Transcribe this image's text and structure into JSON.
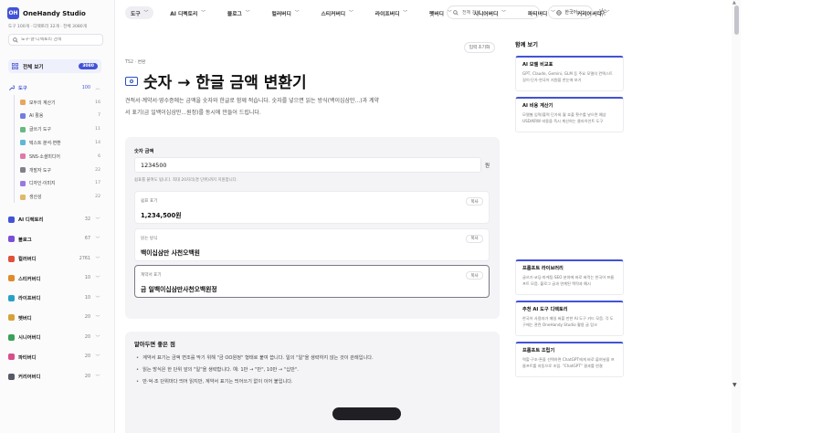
{
  "brand": {
    "logo_mark": "OH",
    "name": "OneHandy Studio"
  },
  "sidebar": {
    "stats": "도구 100개 · 디렉토리 32개 · 전체 3080개",
    "search_placeholder": "도구·글·디렉토리 검색",
    "all_view": {
      "label": "전체 보기",
      "count": "3080"
    },
    "tools": {
      "label": "도구",
      "count": "100"
    },
    "subitems": [
      {
        "label": "모두의 계산기",
        "count": "16"
      },
      {
        "label": "AI 활용",
        "count": "7"
      },
      {
        "label": "글쓰기 도구",
        "count": "11"
      },
      {
        "label": "텍스트 분석·변환",
        "count": "14"
      },
      {
        "label": "SNS·소셜미디어",
        "count": "6"
      },
      {
        "label": "개발자 도구",
        "count": "22"
      },
      {
        "label": "디자인·이미지",
        "count": "17"
      },
      {
        "label": "생산성",
        "count": "22"
      }
    ],
    "categories": [
      {
        "label": "AI 디렉토리",
        "count": "32",
        "color": "#4353d6"
      },
      {
        "label": "블로그",
        "count": "67",
        "color": "#7a4fd6"
      },
      {
        "label": "컬러버디",
        "count": "2761",
        "color": "#e0503a"
      },
      {
        "label": "스티커버디",
        "count": "10",
        "color": "#e08a2a"
      },
      {
        "label": "라이프버디",
        "count": "10",
        "color": "#2aa0c8"
      },
      {
        "label": "펫버디",
        "count": "20",
        "color": "#d6a23a"
      },
      {
        "label": "시니어버디",
        "count": "20",
        "color": "#3aa05a"
      },
      {
        "label": "파티버디",
        "count": "20",
        "color": "#d64f8a"
      },
      {
        "label": "커리어버디",
        "count": "20",
        "color": "#555a66"
      }
    ]
  },
  "topnav": {
    "items": [
      "도구",
      "AI 디렉토리",
      "블로그",
      "컬러버디",
      "스티커버디",
      "라이프버디",
      "펫버디",
      "시니어버디",
      "파티버디",
      "커리어버디"
    ],
    "search_placeholder": "전체 검색...",
    "language": "한국어"
  },
  "main": {
    "reset_label": "입력 초기화",
    "breadcrumb": [
      "TS2",
      "변환"
    ],
    "title": "숫자 → 한글 금액 변환기",
    "description": "견적서·계약서·영수증에는 금액을 숫자와 한글로 함께 적습니다. 숫자를 넣으면 읽는 방식(백이십삼만...)과 계약서 표기(금 일백이십삼만...원정)를 동시에 만들어 드립니다.",
    "input_label": "숫자 금액",
    "input_value": "1234500",
    "unit": "원",
    "hint": "쉼표를 붙여도 됩니다. 최대 20자리(경 단위)까지 지원합니다.",
    "results": [
      {
        "label": "쉼표 표기",
        "value": "1,234,500원"
      },
      {
        "label": "읽는 방식",
        "value": "백이십삼만 사천오백원"
      },
      {
        "label": "계약서 표기",
        "value": "금 일백이십삼만사천오백원정"
      }
    ],
    "copy_label": "복사",
    "tips_title": "알아두면 좋은 점",
    "tips": [
      "계약서 표기는 금액 변조를 막기 위해 \"금 OO원정\" 형태로 붙여 씁니다. 일의 \"일\"을 생략하지 않는 것이 관례입니다.",
      "읽는 방식은 한 단위 앞의 \"일\"을 생략합니다. 예: 1만 → \"만\", 10만 → \"십만\".",
      "만·억·조 단위마다 띄어 읽지만, 계약서 표기는 띄어쓰기 없이 이어 붙입니다."
    ]
  },
  "related": {
    "title": "함께 보기",
    "cards_top": [
      {
        "title": "AI 모델 비교표",
        "desc": "GPT, Claude, Gemini, GLM 등 주요 모델의 컨텍스트 길이·단가·한국어 지원을 한눈에 보기"
      },
      {
        "title": "AI 비용 계산기",
        "desc": "모델별 입력/출력 단가와 월 호출 횟수를 넣으면 예상 USD/KRW 비용을 즉시 계산하는 클라이언트 도구"
      }
    ],
    "cards_bottom": [
      {
        "title": "프롬프트 라이브러리",
        "desc": "글쓰기·코딩·마케팅·SEO 분야에 바로 써먹는 한국어 프롬프트 모음. 블로그 글과 연계된 맥락과 예시"
      },
      {
        "title": "추천 AI 도구 디렉토리",
        "desc": "한국어 사용자가 매일 써볼 만한 AI 도구 카드 모음. 각 도구에는 관련 OneHandy Studio 활용 글 링크"
      },
      {
        "title": "프롬프트 조립기",
        "desc": "역할·구조·톤을 선택하면 ChatGPT에게 바로 붙여넣을 프롬프트를 자동으로 조립. \"ChatGPT\" 결과를 연결"
      }
    ]
  }
}
